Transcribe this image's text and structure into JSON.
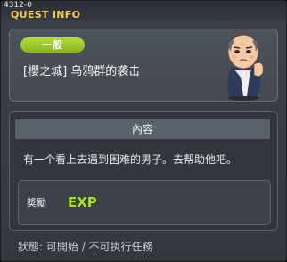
{
  "window": {
    "quest_id": "4312-0",
    "title": "QUEST INFO"
  },
  "quest": {
    "badge": "一般",
    "name": "[櫻之城] 乌鸦群的袭击",
    "npc_icon": "npc-portrait"
  },
  "content": {
    "header": "內容",
    "description": "有一个看上去遇到困难的男子。去帮助他吧。"
  },
  "reward": {
    "label": "奬勵",
    "exp_label": "EXP"
  },
  "status": {
    "text": "狀態: 可開始 / 不可执行任務"
  },
  "colors": {
    "title": "#f4d24a",
    "badge": "#9dc92b",
    "exp": "#a8e02a"
  }
}
